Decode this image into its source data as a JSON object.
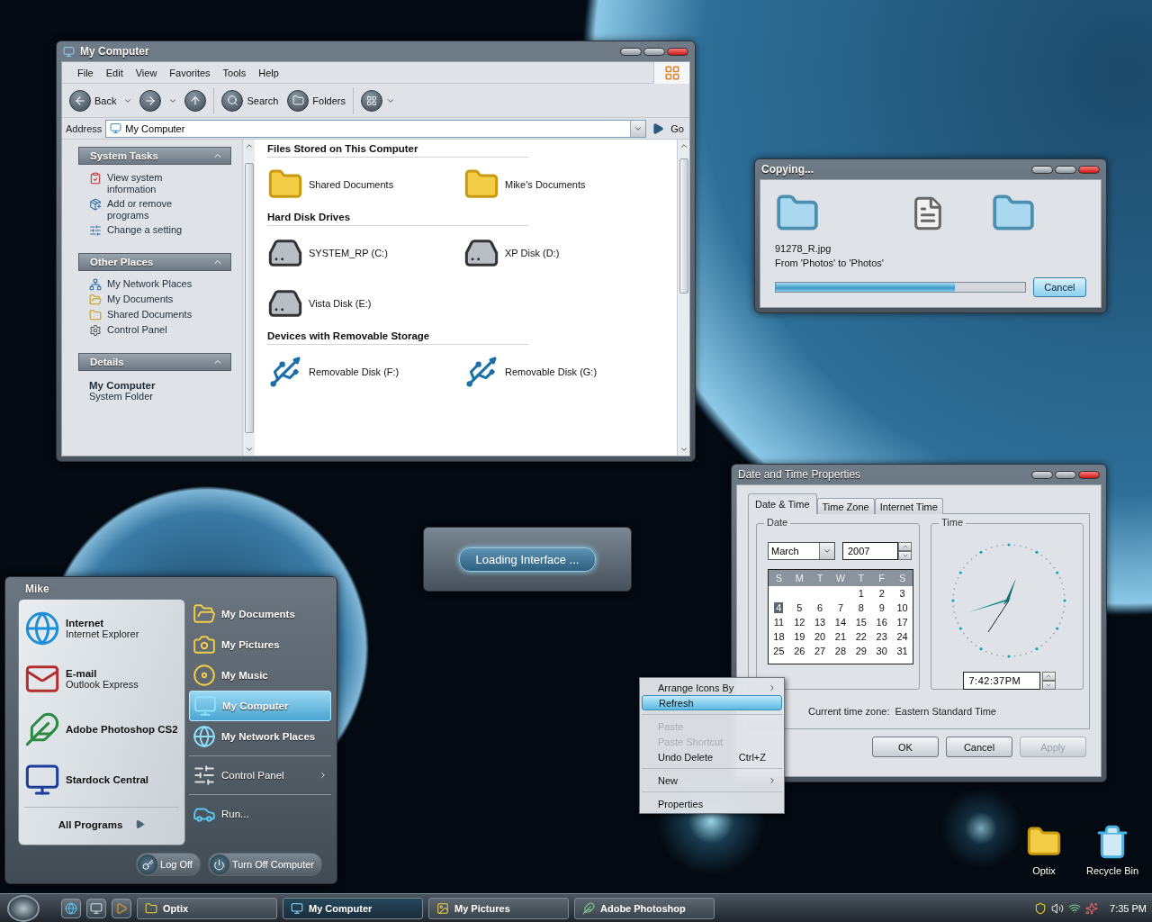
{
  "explorer": {
    "title": "My Computer",
    "menu": [
      "File",
      "Edit",
      "View",
      "Favorites",
      "Tools",
      "Help"
    ],
    "toolbar": {
      "back": "Back",
      "search": "Search",
      "folders": "Folders"
    },
    "address": {
      "label": "Address",
      "value": "My Computer",
      "go": "Go"
    },
    "panels": [
      {
        "title": "System Tasks",
        "expanded": true,
        "items": [
          {
            "label": "View system information",
            "kind": "info"
          },
          {
            "label": "Add or remove programs",
            "kind": "programs"
          },
          {
            "label": "Change a setting",
            "kind": "setting"
          }
        ]
      },
      {
        "title": "Other Places",
        "expanded": true,
        "items": [
          {
            "label": "My Network Places",
            "kind": "network"
          },
          {
            "label": "My Documents",
            "kind": "documents"
          },
          {
            "label": "Shared Documents",
            "kind": "shared"
          },
          {
            "label": "Control Panel",
            "kind": "control"
          }
        ]
      }
    ],
    "details": {
      "title": "Details",
      "expanded": true,
      "name": "My Computer",
      "type": "System Folder"
    },
    "groups": [
      {
        "title": "Files Stored on This Computer",
        "items": [
          {
            "label": "Shared Documents",
            "kind": "folder"
          },
          {
            "label": "Mike's Documents",
            "kind": "folder"
          }
        ]
      },
      {
        "title": "Hard Disk Drives",
        "items": [
          {
            "label": "SYSTEM_RP (C:)",
            "kind": "drive"
          },
          {
            "label": "XP Disk (D:)",
            "kind": "drive"
          },
          {
            "label": "Vista Disk (E:)",
            "kind": "drive"
          }
        ]
      },
      {
        "title": "Devices with Removable Storage",
        "items": [
          {
            "label": "Removable Disk (F:)",
            "kind": "usb"
          },
          {
            "label": "Removable Disk (G:)",
            "kind": "usb"
          }
        ]
      }
    ]
  },
  "copy_dialog": {
    "title": "Copying...",
    "file": "91278_R.jpg",
    "route": "From 'Photos' to 'Photos'",
    "level": 0.72,
    "cancel": "Cancel"
  },
  "loading": {
    "label": "Loading Interface ..."
  },
  "datetime": {
    "title": "Date and Time Properties",
    "tabs": [
      {
        "label": "Date & Time",
        "selected": true
      },
      {
        "label": "Time Zone",
        "selected": false
      },
      {
        "label": "Internet Time",
        "selected": false
      }
    ],
    "date_group": "Date",
    "month": "March",
    "year": "2007",
    "weekdays": [
      "S",
      "M",
      "T",
      "W",
      "T",
      "F",
      "S"
    ],
    "weeks": [
      {
        "kind": "partial",
        "days": [
          {
            "d": "1",
            "selected": false
          },
          {
            "d": "2",
            "selected": false
          },
          {
            "d": "3",
            "selected": false
          }
        ]
      },
      {
        "kind": "full",
        "days": [
          {
            "d": "4",
            "selected": true
          },
          {
            "d": "5",
            "selected": false
          },
          {
            "d": "6",
            "selected": false
          },
          {
            "d": "7",
            "selected": false
          },
          {
            "d": "8",
            "selected": false
          },
          {
            "d": "9",
            "selected": false
          },
          {
            "d": "10",
            "selected": false
          }
        ]
      },
      {
        "kind": "full",
        "days": [
          {
            "d": "11",
            "selected": false
          },
          {
            "d": "12",
            "selected": false
          },
          {
            "d": "13",
            "selected": false
          },
          {
            "d": "14",
            "selected": false
          },
          {
            "d": "15",
            "selected": false
          },
          {
            "d": "16",
            "selected": false
          },
          {
            "d": "17",
            "selected": false
          }
        ]
      },
      {
        "kind": "full",
        "days": [
          {
            "d": "18",
            "selected": false
          },
          {
            "d": "19",
            "selected": false
          },
          {
            "d": "20",
            "selected": false
          },
          {
            "d": "21",
            "selected": false
          },
          {
            "d": "22",
            "selected": false
          },
          {
            "d": "23",
            "selected": false
          },
          {
            "d": "24",
            "selected": false
          }
        ]
      },
      {
        "kind": "full",
        "days": [
          {
            "d": "25",
            "selected": false
          },
          {
            "d": "26",
            "selected": false
          },
          {
            "d": "27",
            "selected": false
          },
          {
            "d": "28",
            "selected": false
          },
          {
            "d": "29",
            "selected": false
          },
          {
            "d": "30",
            "selected": false
          },
          {
            "d": "31",
            "selected": false
          }
        ]
      }
    ],
    "time_group": "Time",
    "time": "7:42:37PM",
    "timezone_label": "Current time zone:",
    "timezone": "Eastern Standard Time",
    "buttons": [
      {
        "label": "OK",
        "disabled": false
      },
      {
        "label": "Cancel",
        "disabled": false
      },
      {
        "label": "Apply",
        "disabled": true
      }
    ]
  },
  "context_menu": [
    {
      "kind": "item",
      "label": "Arrange Icons By",
      "selected": false,
      "disabled": false,
      "submenu": true
    },
    {
      "kind": "item",
      "label": "Refresh",
      "selected": true,
      "disabled": false,
      "submenu": false
    },
    {
      "kind": "separator"
    },
    {
      "kind": "item",
      "label": "Paste",
      "selected": false,
      "disabled": true,
      "submenu": false
    },
    {
      "kind": "item",
      "label": "Paste Shortcut",
      "selected": false,
      "disabled": true,
      "submenu": false
    },
    {
      "kind": "item",
      "label": "Undo Delete",
      "shortcut": "Ctrl+Z",
      "selected": false,
      "disabled": false,
      "submenu": false
    },
    {
      "kind": "separator"
    },
    {
      "kind": "item",
      "label": "New",
      "selected": false,
      "disabled": false,
      "submenu": true
    },
    {
      "kind": "separator"
    },
    {
      "kind": "item",
      "label": "Properties",
      "selected": false,
      "disabled": false,
      "submenu": false
    }
  ],
  "start_menu": {
    "user": "Mike",
    "pinned": [
      {
        "title": "Internet",
        "subtitle": "Internet Explorer",
        "kind": "browser"
      },
      {
        "title": "E-mail",
        "subtitle": "Outlook Express",
        "kind": "email"
      },
      {
        "title": "Adobe Photoshop CS2",
        "kind": "photoshop"
      },
      {
        "title": "Stardock Central",
        "kind": "stardock"
      }
    ],
    "all_programs": "All Programs",
    "places": [
      {
        "label": "My Documents",
        "kind": "documents",
        "selected": false
      },
      {
        "label": "My Pictures",
        "kind": "pictures",
        "selected": false
      },
      {
        "label": "My Music",
        "kind": "music",
        "selected": false
      },
      {
        "label": "My Computer",
        "kind": "computer",
        "selected": true
      },
      {
        "label": "My Network Places",
        "kind": "network",
        "selected": false
      }
    ],
    "system": [
      {
        "label": "Control Panel",
        "kind": "control",
        "submenu": true
      }
    ],
    "commands": [
      {
        "label": "Run...",
        "kind": "run"
      }
    ],
    "log_off": "Log Off",
    "turn_off": "Turn Off Computer"
  },
  "desktop_icons": [
    {
      "label": "Optix",
      "kind": "folder"
    },
    {
      "label": "Recycle Bin",
      "kind": "bin"
    }
  ],
  "taskbar": {
    "quick_launch": [
      {
        "kind": "browser"
      },
      {
        "kind": "desktop"
      },
      {
        "kind": "media"
      }
    ],
    "tasks": [
      {
        "label": "Optix",
        "kind": "folder",
        "selected": false
      },
      {
        "label": "My Computer",
        "kind": "computer",
        "selected": true
      },
      {
        "label": "My Pictures",
        "kind": "pictures",
        "selected": false
      },
      {
        "label": "Adobe Photoshop",
        "kind": "photoshop",
        "selected": false
      }
    ],
    "clock": "7:35 PM"
  }
}
